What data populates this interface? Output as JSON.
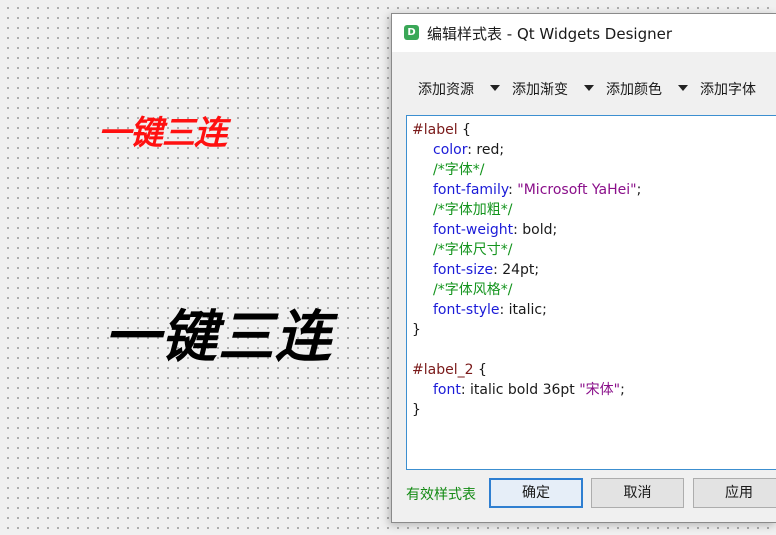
{
  "canvas": {
    "label_red_text": "一键三连",
    "label_black_text": "一键三连"
  },
  "dialog": {
    "icon_letter": "D",
    "title": "编辑样式表 - Qt Widgets Designer",
    "toolbar": {
      "add_resource": "添加资源",
      "add_gradient": "添加渐变",
      "add_color": "添加颜色",
      "add_font": "添加字体"
    },
    "editor": {
      "l1_sel": "#label",
      "l1_brace": " {",
      "l2_prop": "color",
      "l2_rest": ": red;",
      "l3_cmt": "/*字体*/",
      "l4_prop": "font-family",
      "l4_colon": ": ",
      "l4_str": "\"Microsoft YaHei\"",
      "l4_end": ";",
      "l5_cmt": "/*字体加粗*/",
      "l6_prop": "font-weight",
      "l6_rest": ": bold;",
      "l7_cmt": "/*字体尺寸*/",
      "l8_prop": "font-size",
      "l8_rest": ": 24pt;",
      "l9_cmt": "/*字体风格*/",
      "l10_prop": "font-style",
      "l10_rest": ": italic;",
      "l11_brace": "}",
      "l13_sel": "#label_2",
      "l13_brace": " {",
      "l14_prop": "font",
      "l14_rest": ": italic bold 36pt ",
      "l14_str": "\"宋体\"",
      "l14_end": ";",
      "l15_brace": "}"
    },
    "status": "有效样式表",
    "buttons": {
      "ok": "确定",
      "cancel": "取消",
      "apply": "应用"
    }
  },
  "colors": {
    "label_red": "#ff1010",
    "comment": "#13941d",
    "property": "#1b1bd8",
    "string": "#8a0f8a",
    "valid_status": "#138a13",
    "focus_border": "#2f7fd1"
  }
}
